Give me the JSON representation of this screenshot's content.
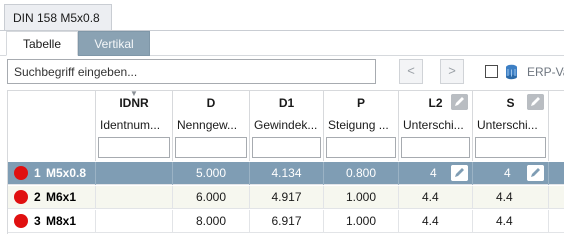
{
  "window": {
    "title_tab": "DIN 158 M5x0.8"
  },
  "view_tabs": [
    {
      "label": "Tabelle",
      "active": true
    },
    {
      "label": "Vertikal",
      "active": false
    }
  ],
  "search": {
    "placeholder": "Suchbegriff eingeben...",
    "value": "",
    "prev_label": "<",
    "next_label": ">",
    "erp_label": "ERP-Va"
  },
  "table": {
    "columns": [
      {
        "name": "IDNR",
        "desc": "Identnum..."
      },
      {
        "name": "D",
        "desc": "Nenngew..."
      },
      {
        "name": "D1",
        "desc": "Gewindek..."
      },
      {
        "name": "P",
        "desc": "Steigung ..."
      },
      {
        "name": "L2",
        "desc": "Unterschi..."
      },
      {
        "name": "S",
        "desc": "Unterschi..."
      }
    ],
    "rows": [
      {
        "index": "1",
        "name": "M5x0.8",
        "selected": true,
        "cells": [
          "",
          "5.000",
          "4.134",
          "0.800",
          "4",
          "4"
        ]
      },
      {
        "index": "2",
        "name": "M6x1",
        "selected": false,
        "cells": [
          "",
          "6.000",
          "4.917",
          "1.000",
          "4.4",
          "4.4"
        ]
      },
      {
        "index": "3",
        "name": "M8x1",
        "selected": false,
        "cells": [
          "",
          "8.000",
          "6.917",
          "1.000",
          "4.4",
          "4.4"
        ]
      }
    ]
  },
  "colors": {
    "selected_row": "#7f9db4",
    "status_dot": "#e01010",
    "inactive_tab": "#8aa2b3"
  },
  "icons": {
    "edit": "pencil-icon",
    "erp": "database-icon",
    "status": "status-dot-icon"
  }
}
